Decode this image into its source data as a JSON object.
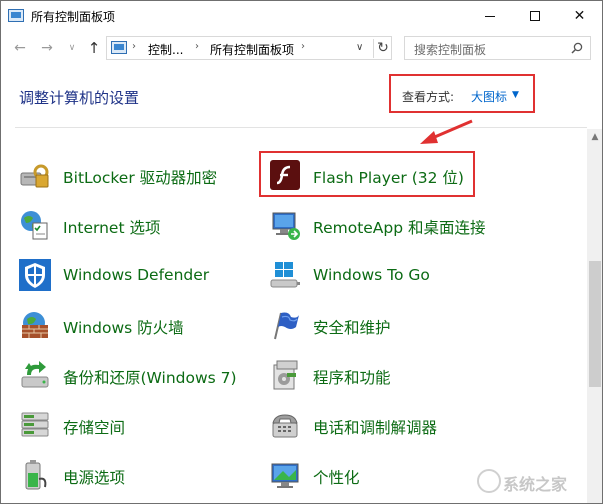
{
  "window": {
    "title": "所有控制面板项"
  },
  "titlebar_buttons": {
    "minimize": "minimize",
    "maximize": "maximize",
    "close": "✕"
  },
  "nav": {
    "back": "←",
    "forward": "→",
    "dropdown": "∨",
    "up": "↑"
  },
  "address": {
    "crumbs": [
      "控制...",
      "所有控制面板项"
    ],
    "separator": "›",
    "dropdown": "∨",
    "refresh": "↻"
  },
  "search": {
    "placeholder": "搜索控制面板"
  },
  "header": {
    "heading": "调整计算机的设置",
    "view_by_label": "查看方式:",
    "view_by_value": "大图标",
    "view_by_caret": "▼"
  },
  "items_left": [
    {
      "label": "BitLocker 驱动器加密",
      "icon": "bitlocker-icon"
    },
    {
      "label": "Internet 选项",
      "icon": "internet-options-icon"
    },
    {
      "label": "Windows Defender",
      "icon": "windows-defender-icon"
    },
    {
      "label": "Windows 防火墙",
      "icon": "firewall-icon"
    },
    {
      "label": "备份和还原(Windows 7)",
      "icon": "backup-restore-icon"
    },
    {
      "label": "存储空间",
      "icon": "storage-spaces-icon"
    },
    {
      "label": "电源选项",
      "icon": "power-options-icon"
    }
  ],
  "items_right": [
    {
      "label": "Flash Player (32 位)",
      "icon": "flash-player-icon"
    },
    {
      "label": "RemoteApp 和桌面连接",
      "icon": "remoteapp-icon"
    },
    {
      "label": "Windows To Go",
      "icon": "windows-to-go-icon"
    },
    {
      "label": "安全和维护",
      "icon": "security-maintenance-icon"
    },
    {
      "label": "程序和功能",
      "icon": "programs-features-icon"
    },
    {
      "label": "电话和调制解调器",
      "icon": "phone-modem-icon"
    },
    {
      "label": "个性化",
      "icon": "personalization-icon"
    }
  ],
  "scrollbar": {
    "up": "▲"
  },
  "watermark": {
    "text": "系统之家"
  },
  "colors": {
    "link_green": "#0c6b14",
    "heading_blue": "#1e3287",
    "accent_blue": "#0066cc",
    "highlight_red": "#e03131"
  }
}
